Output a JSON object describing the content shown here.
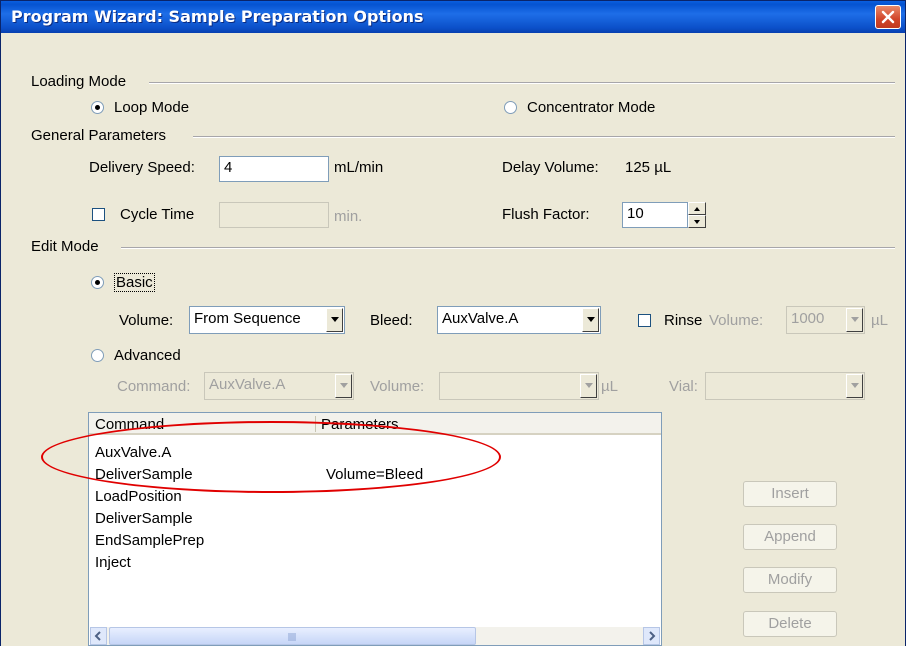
{
  "window": {
    "title": "Program Wizard: Sample Preparation Options"
  },
  "loading_mode": {
    "label": "Loading Mode",
    "loop_mode": "Loop Mode",
    "concentrator_mode": "Concentrator Mode",
    "selected": "Loop Mode"
  },
  "general": {
    "label": "General Parameters",
    "delivery_speed_label": "Delivery Speed:",
    "delivery_speed_value": "4",
    "delivery_speed_unit": "mL/min",
    "delay_volume_label": "Delay Volume:",
    "delay_volume_value": "125 µL",
    "cycle_time_label": "Cycle Time",
    "cycle_time_unit": "min.",
    "flush_factor_label": "Flush Factor:",
    "flush_factor_value": "10"
  },
  "edit_mode": {
    "label": "Edit Mode",
    "basic_label": "Basic",
    "volume_label": "Volume:",
    "volume_value": "From Sequence",
    "bleed_label": "Bleed:",
    "bleed_value": "AuxValve.A",
    "rinse_label": "Rinse",
    "rinse_volume_label": "Volume:",
    "rinse_volume_value": "1000",
    "rinse_unit": "µL",
    "advanced_label": "Advanced",
    "command_label": "Command:",
    "command_value": "AuxValve.A",
    "adv_volume_label": "Volume:",
    "adv_volume_unit": "µL",
    "vial_label": "Vial:"
  },
  "table": {
    "headers": [
      "Command",
      "Parameters"
    ],
    "rows": [
      {
        "command": "AuxValve.A",
        "parameters": ""
      },
      {
        "command": "DeliverSample",
        "parameters": "Volume=Bleed"
      },
      {
        "command": "LoadPosition",
        "parameters": ""
      },
      {
        "command": "DeliverSample",
        "parameters": ""
      },
      {
        "command": "EndSamplePrep",
        "parameters": ""
      },
      {
        "command": "Inject",
        "parameters": ""
      }
    ]
  },
  "buttons": {
    "insert": "Insert",
    "append": "Append",
    "modify": "Modify",
    "delete": "Delete"
  },
  "icons": {
    "close": "close-icon",
    "scroll_left": "arrow-left-icon",
    "scroll_right": "arrow-right-icon",
    "thumb_grip": "grip-icon"
  },
  "colors": {
    "title_bar": "#0553d1",
    "close": "#d1452a",
    "annotation": "#e00000"
  }
}
